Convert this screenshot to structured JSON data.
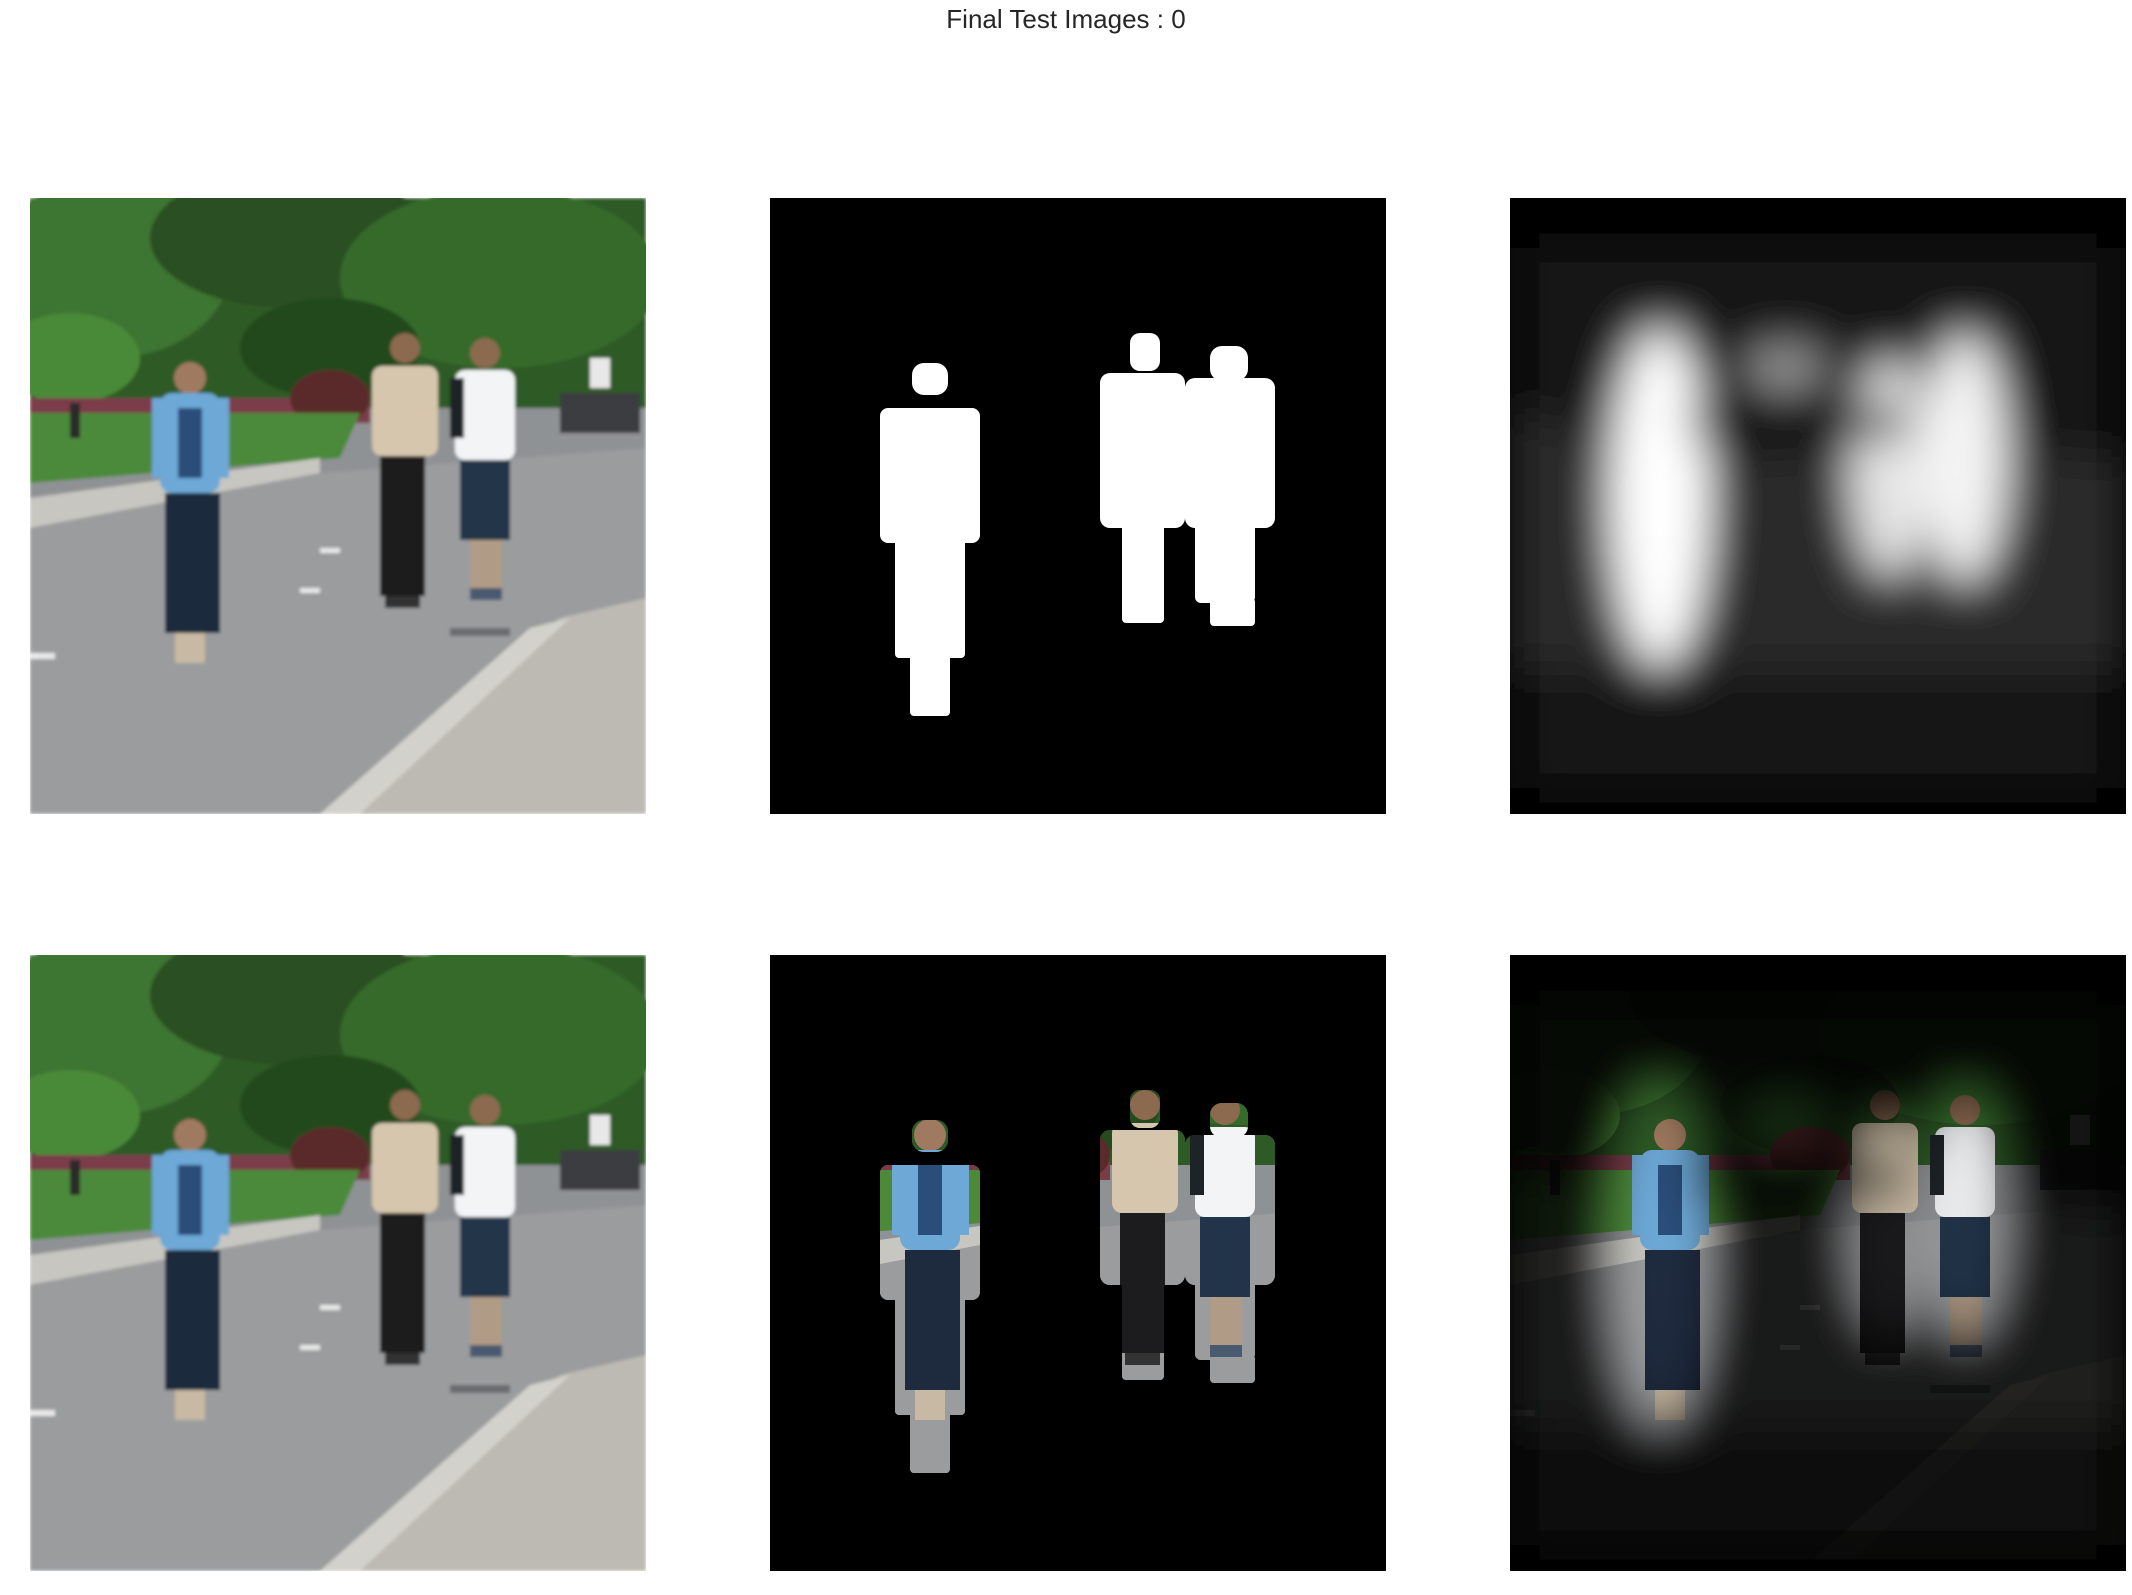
{
  "figure": {
    "title": "Final Test Images : 0"
  },
  "panels": [
    {
      "id": "input-image",
      "content": "street photo of three people walking"
    },
    {
      "id": "ground-truth-mask",
      "content": "binary mask of three pedestrians"
    },
    {
      "id": "predicted-mask",
      "content": "blurred saliency / predicted mask"
    },
    {
      "id": "input-image-copy",
      "content": "street photo of three people walking"
    },
    {
      "id": "masked-ground-truth",
      "content": "pedestrians cut out on black"
    },
    {
      "id": "masked-prediction",
      "content": "photo weighted by predicted mask"
    }
  ],
  "colors": {
    "background": "#ffffff",
    "title": "#262626",
    "foliage": "#2e5a26",
    "road": "#8f9294",
    "grass": "#4c8a3a",
    "mask_fg": "#ffffff",
    "mask_bg": "#000000"
  }
}
